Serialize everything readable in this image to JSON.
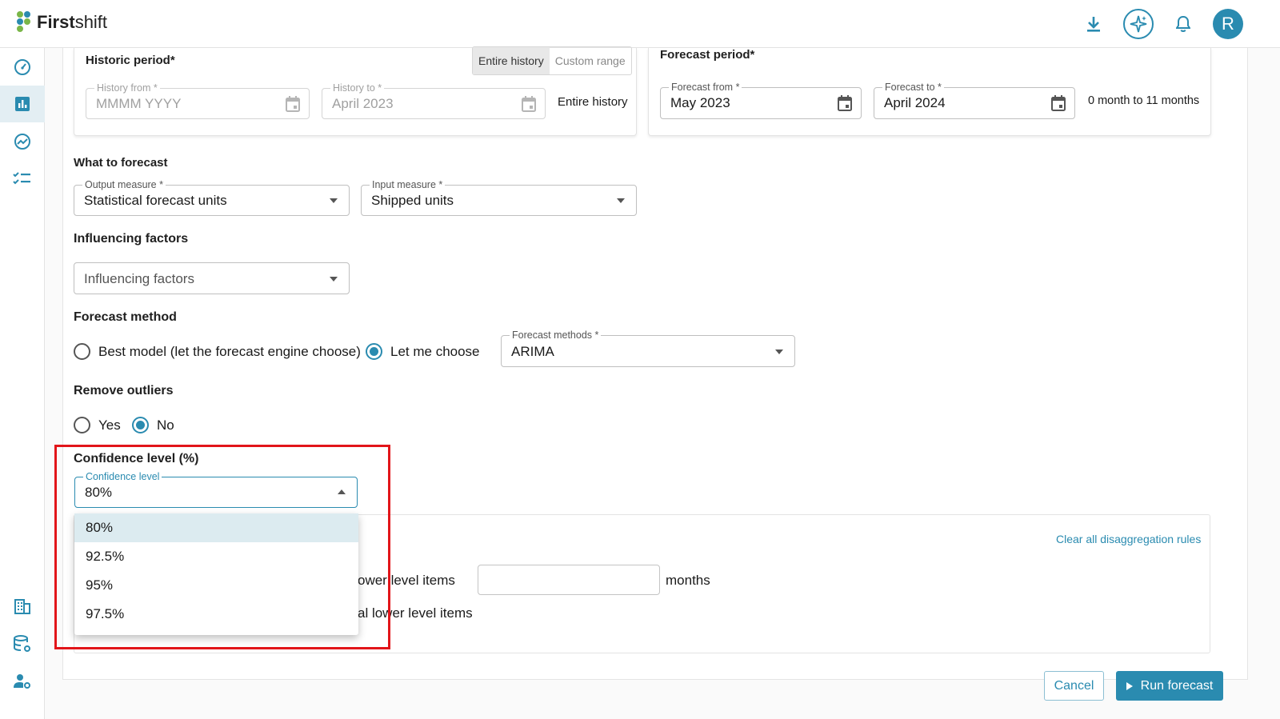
{
  "header": {
    "logo_bold": "First",
    "logo_rest": "shift",
    "avatar_initial": "R"
  },
  "sidebar": {
    "icons": [
      "speedometer-icon",
      "bar-chart-icon",
      "trend-icon",
      "checklist-icon",
      "building-icon",
      "database-settings-icon",
      "user-settings-icon"
    ],
    "active": "bar-chart-icon"
  },
  "historic": {
    "title": "Historic period*",
    "toggle": [
      "Entire history",
      "Custom range"
    ],
    "toggle_selected": "Entire history",
    "history_from_label": "History from *",
    "history_from_placeholder": "MMMM YYYY",
    "history_to_label": "History to *",
    "history_to_value": "April 2023",
    "summary": "Entire history"
  },
  "forecast_period": {
    "title": "Forecast period*",
    "from_label": "Forecast from *",
    "from_value": "May 2023",
    "to_label": "Forecast to *",
    "to_value": "April 2024",
    "summary": "0 month to 11 months"
  },
  "what_to_forecast": {
    "title": "What to forecast",
    "output_label": "Output measure *",
    "output_value": "Statistical forecast units",
    "input_label": "Input measure *",
    "input_value": "Shipped units"
  },
  "influencing": {
    "title": "Influencing factors",
    "placeholder": "Influencing factors"
  },
  "forecast_method": {
    "title": "Forecast method",
    "option_best": "Best model (let the forecast engine choose)",
    "option_choose": "Let me choose",
    "selected": "Let me choose",
    "methods_label": "Forecast methods *",
    "methods_value": "ARIMA"
  },
  "outliers": {
    "title": "Remove outliers",
    "option_yes": "Yes",
    "option_no": "No",
    "selected": "No"
  },
  "confidence": {
    "title": "Confidence level (%)",
    "label": "Confidence level",
    "value": "80%",
    "options": [
      "80%",
      "92.5%",
      "95%",
      "97.5%"
    ],
    "selected": "80%"
  },
  "disaggregation": {
    "clear_link": "Clear all disaggregation rules",
    "partial_1": "ower level items",
    "months": "months",
    "partial_2": "al lower level items"
  },
  "footer": {
    "cancel": "Cancel",
    "run": "Run forecast"
  },
  "colors": {
    "accent": "#2a8bb0",
    "highlight": "#e2151a"
  }
}
